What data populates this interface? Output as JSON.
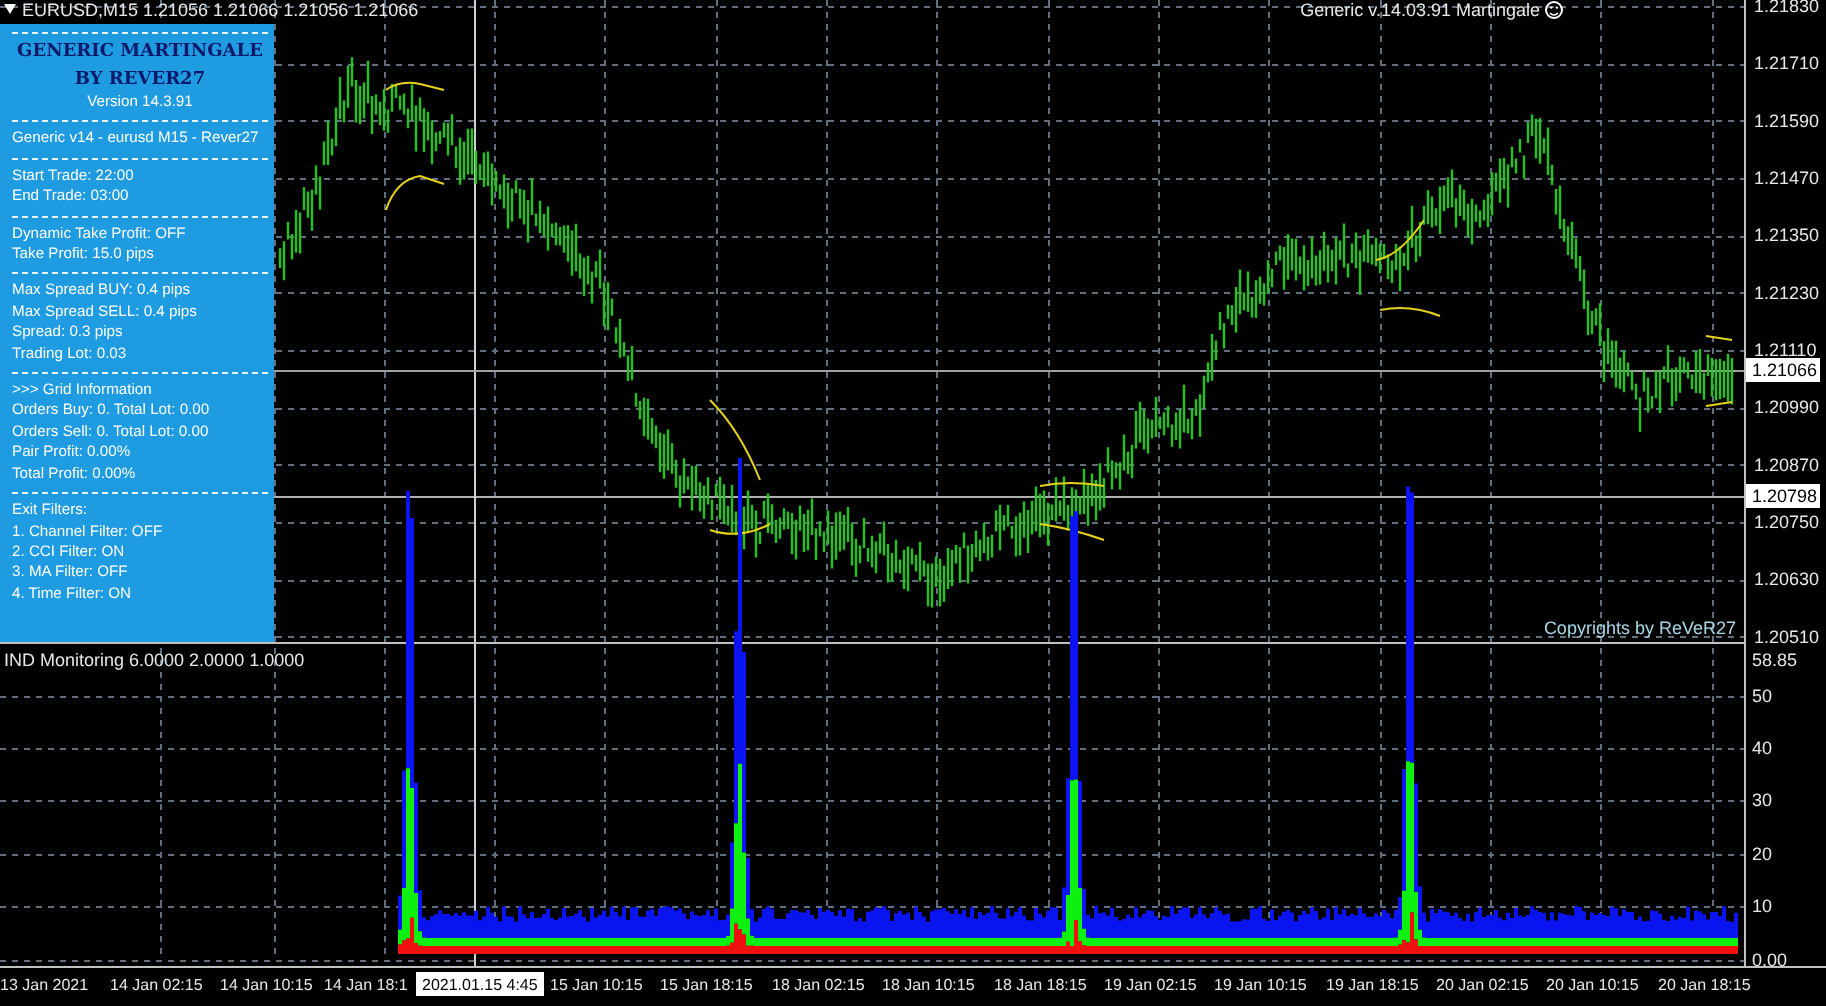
{
  "chart_header": {
    "symbol_line": "EURUSD,M15  1.21056 1.21066 1.21056 1.21066",
    "ea_label": "Generic v.14.03.91 Martingale"
  },
  "info_panel": {
    "title_lines": [
      "GENERIC MARTINGALE",
      "BY REVER27"
    ],
    "version": "Version 14.3.91",
    "sections": [
      [
        "Generic v14 - eurusd M15 - Rever27"
      ],
      [
        "Start Trade: 22:00",
        "End Trade:  03:00"
      ],
      [
        "Dynamic Take Profit: OFF",
        "Take Profit: 15.0 pips"
      ],
      [
        "Max Spread BUY: 0.4 pips",
        "Max Spread SELL: 0.4 pips",
        "Spread: 0.3 pips",
        "Trading Lot: 0.03"
      ],
      [
        ">>> Grid Information",
        "Orders Buy: 0. Total Lot: 0.00",
        "Orders Sell: 0. Total Lot: 0.00",
        "Pair Profit: 0.00%",
        "Total Profit: 0.00%"
      ],
      [
        "Exit Filters:",
        "1. Channel Filter: OFF",
        "2. CCI Filter: ON",
        "3. MA Filter: OFF",
        "4. Time Filter: ON"
      ]
    ]
  },
  "copyright": "Copyrights by ReVeR27",
  "price_axis": {
    "labels": [
      "1.21830",
      "1.21710",
      "1.21590",
      "1.21470",
      "1.21350",
      "1.21230",
      "1.21110",
      "1.20990",
      "1.20870",
      "1.20750",
      "1.20630",
      "1.20510"
    ],
    "markers": [
      {
        "text": "1.21066",
        "kind": "price"
      },
      {
        "text": "1.20798",
        "kind": "cursor"
      }
    ]
  },
  "indicator": {
    "title": "IND Monitoring 6.0000 2.0000 1.0000",
    "axis_labels": [
      "58.85",
      "50",
      "40",
      "30",
      "20",
      "10",
      "0.00"
    ]
  },
  "time_axis": {
    "labels": [
      "13 Jan 2021",
      "14 Jan 02:15",
      "14 Jan 10:15",
      "14 Jan 18:1",
      "15 Jan 10:15",
      "15 Jan 18:15",
      "18 Jan 02:15",
      "18 Jan 10:15",
      "18 Jan 18:15",
      "19 Jan 02:15",
      "19 Jan 10:15",
      "19 Jan 18:15",
      "20 Jan 02:15",
      "20 Jan 10:15",
      "20 Jan 18:15"
    ],
    "cursor_time": "2021.01.15 4:45"
  }
}
